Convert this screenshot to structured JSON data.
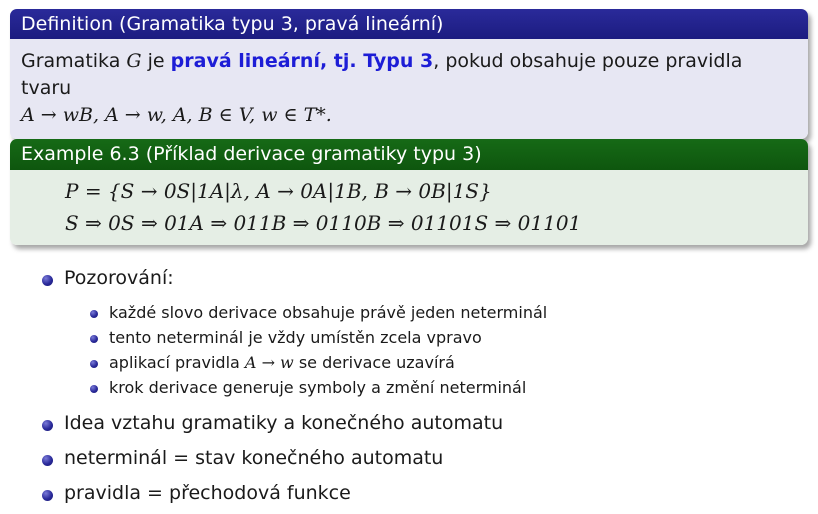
{
  "definition": {
    "header": "Definition (Gramatika typu 3, pravá lineární)",
    "line1_prefix": "Gramatika ",
    "line1_G": "G",
    "line1_je": " je ",
    "line1_strong": "pravá lineární, tj. Typu 3",
    "line1_suffix": ", pokud obsahuje pouze pravidla tvaru",
    "line2": "A → wB, A → w, A, B ∈ V, w ∈ T*."
  },
  "example": {
    "header": "Example 6.3 (Příklad derivace gramatiky typu 3)",
    "rules": "P = {S → 0S|1A|λ,  A → 0A|1B,  B → 0B|1S}",
    "derivation": "S ⇒ 0S ⇒ 01A ⇒ 011B ⇒ 0110B ⇒ 01101S ⇒ 01101"
  },
  "list": {
    "observation": "Pozorování:",
    "subitems": [
      "každé slovo derivace obsahuje právě jeden neterminál",
      "tento neterminál je vždy umístěn zcela vpravo",
      "krok derivace generuje symboly a změní neterminál"
    ],
    "sub3_prefix": "aplikací pravidla ",
    "sub3_math": "A → w",
    "sub3_suffix": " se derivace uzavírá",
    "items": [
      "Idea vztahu gramatiky a konečného automatu",
      "neterminál = stav konečného automatu",
      "pravidla = přechodová funkce"
    ]
  },
  "colors": {
    "definition_header": "#1c1c80",
    "definition_body": "#e7e7f3",
    "example_header": "#0e560e",
    "example_body": "#e5eee5",
    "emphasis": "#1d1dd6"
  }
}
